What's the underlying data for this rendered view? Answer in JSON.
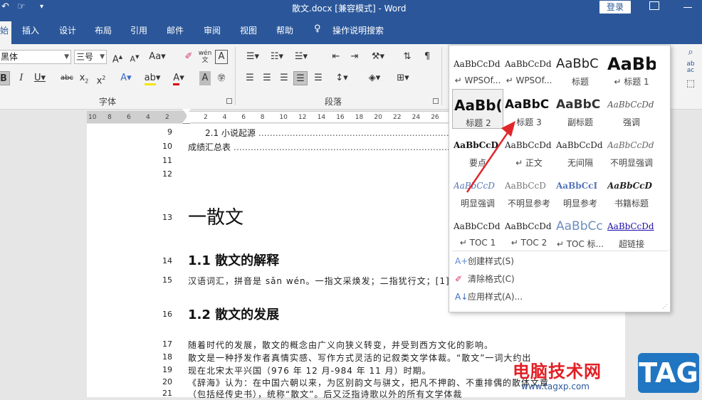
{
  "titlebar": {
    "title": "散文.docx [兼容模式] - Word",
    "login": "登录"
  },
  "tabs": [
    {
      "label": "插入"
    },
    {
      "label": "设计"
    },
    {
      "label": "布局"
    },
    {
      "label": "引用"
    },
    {
      "label": "邮件"
    },
    {
      "label": "审阅"
    },
    {
      "label": "视图"
    },
    {
      "label": "帮助"
    },
    {
      "label": "操作说明搜索"
    }
  ],
  "font": {
    "family": "黑体",
    "size": "三号"
  },
  "groups": {
    "font_label": "字体",
    "paragraph_label": "段落"
  },
  "ruler": {
    "ticks": [
      "10",
      "8",
      "6",
      "4",
      "2",
      "2",
      "4",
      "6",
      "8",
      "10",
      "12",
      "14",
      "16",
      "18",
      "20",
      "22",
      "24",
      "26"
    ]
  },
  "document": {
    "lines": [
      {
        "num": "9",
        "text": "2.1 小说起源"
      },
      {
        "num": "10",
        "text": "成绩汇总表"
      },
      {
        "num": "11",
        "text": ""
      },
      {
        "num": "12",
        "text": ""
      }
    ],
    "h1": {
      "num": "13",
      "text": "一散文"
    },
    "h2_1": {
      "num": "14",
      "text": "1.1 散文的解释"
    },
    "p15": {
      "num": "15",
      "text": "汉语词汇，拼音是 sǎn wén。一指文采焕发；二指犹行文；[1]三"
    },
    "h2_2": {
      "num": "16",
      "text": "1.2 散文的发展"
    },
    "p17": {
      "num": "17",
      "text": "随着时代的发展，散文的概念由广义向狭义转变，并受到西方文化的影响。"
    },
    "p18": {
      "num": "18",
      "text": "散文是一种抒发作者真情实感、写作方式灵活的记叙类文学体裁。“散文”一词大约出"
    },
    "p19": {
      "num": "19",
      "text": "现在北宋太平兴国（976 年 12 月-984 年 11 月）时期。"
    },
    "p20": {
      "num": "20",
      "text": "《辞海》认为：在中国六朝以来，为区别韵文与骈文，把凡不押韵、不重排偶的散体文章"
    },
    "p21": {
      "num": "21",
      "text": "（包括经传史书），统称“散文”。后又泛指诗歌以外的所有文学体裁"
    }
  },
  "styles_panel": {
    "styles": [
      {
        "preview": "AaBbCcDd",
        "name": "↵ WPSOf..."
      },
      {
        "preview": "AaBbCcDd",
        "name": "↵ WPSOf..."
      },
      {
        "preview": "AaBbC",
        "name": "标题"
      },
      {
        "preview": "AaBb",
        "name": "↵ 标题 1"
      },
      {
        "preview": "AaBb(",
        "name": "标题 2"
      },
      {
        "preview": "AaBbC",
        "name": "标题 3"
      },
      {
        "preview": "AaBbC",
        "name": "副标题"
      },
      {
        "preview": "AaBbCcDd",
        "name": "强调"
      },
      {
        "preview": "AaBbCcD",
        "name": "要点"
      },
      {
        "preview": "AaBbCcDd",
        "name": "↵ 正文"
      },
      {
        "preview": "AaBbCcDd",
        "name": "无间隔"
      },
      {
        "preview": "AaBbCcDd",
        "name": "不明显强调"
      },
      {
        "preview": "AaBbCcD",
        "name": "明显强调"
      },
      {
        "preview": "AaBbCcD",
        "name": "不明显参考"
      },
      {
        "preview": "AaBbCcI",
        "name": "明显参考"
      },
      {
        "preview": "AaBbCcD",
        "name": "书籍标题"
      },
      {
        "preview": "AaBbCcDd",
        "name": "↵ TOC 1"
      },
      {
        "preview": "AaBbCcDd",
        "name": "↵ TOC 2"
      },
      {
        "preview": "AaBbCc",
        "name": "↵ TOC 标..."
      },
      {
        "preview": "AaBbCcDd",
        "name": "超链接"
      }
    ],
    "actions": [
      {
        "label": "创建样式(S)"
      },
      {
        "label": "清除格式(C)"
      },
      {
        "label": "应用样式(A)..."
      }
    ]
  },
  "watermark": {
    "site": "电脑技术网",
    "url": "www.tagxp.com",
    "tag": "TAG"
  },
  "colors": {
    "word_blue": "#2b579a",
    "arrow_red": "#e0282c",
    "hyperlink": "#1a0dab"
  }
}
